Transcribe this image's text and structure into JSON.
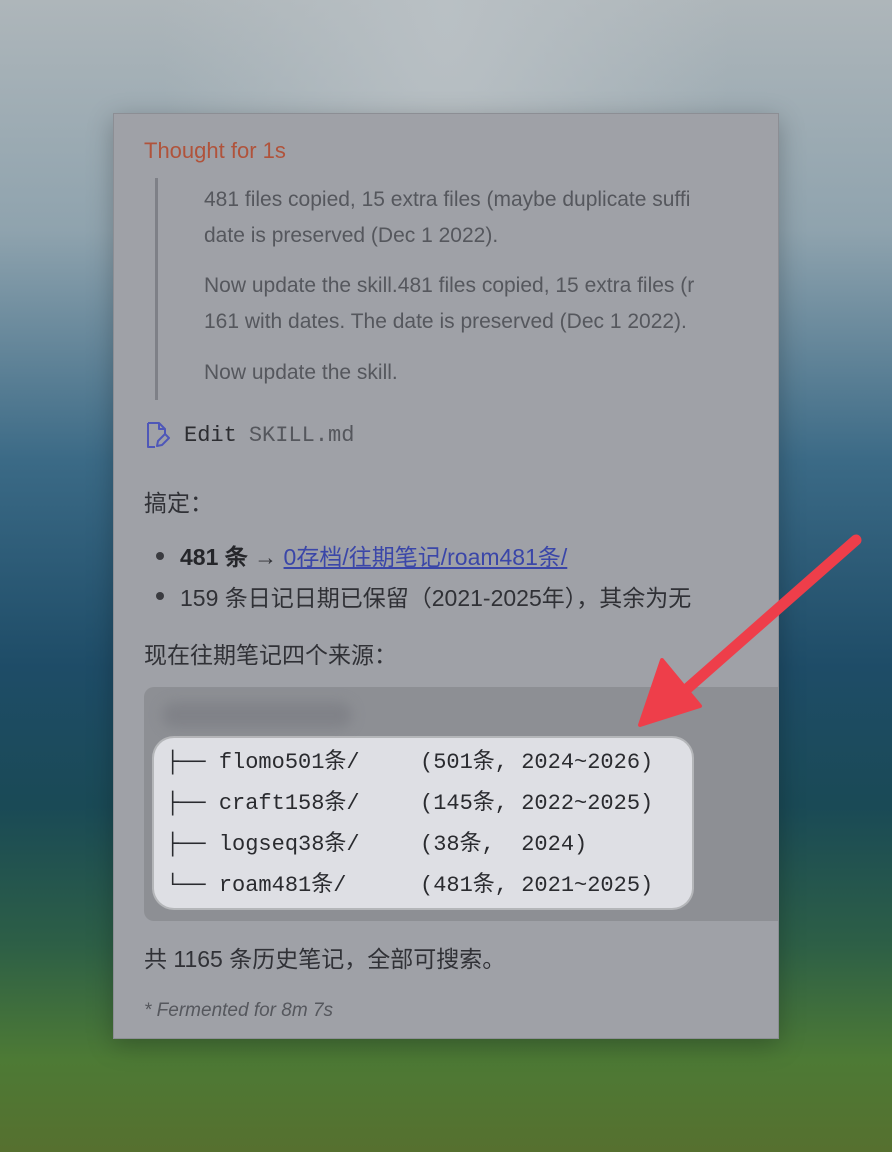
{
  "thought": {
    "title": "Thought for 1s",
    "paragraphs": [
      [
        "481 files copied, 15 extra files (maybe duplicate suffi",
        "date is preserved (Dec 1 2022)."
      ],
      [
        "Now update the skill.481 files copied, 15 extra files (r",
        "161 with dates. The date is preserved (Dec 1 2022)."
      ],
      [
        "Now update the skill."
      ]
    ]
  },
  "edit": {
    "action": "Edit",
    "file": "SKILL.md",
    "icon": "file-edit-icon"
  },
  "message": {
    "done": "搞定：",
    "bullets": [
      {
        "count": "481 条",
        "arrow": "→",
        "link": "0存档/往期笔记/roam481条/"
      },
      {
        "text": "159 条日记日期已保留（2021-2025年），其余为无"
      }
    ],
    "sources_intro": "现在往期笔记四个来源：",
    "tree": [
      {
        "prefix": "├── ",
        "name": "flomo501条/",
        "info": "(501条, 2024~2026)"
      },
      {
        "prefix": "├── ",
        "name": "craft158条/",
        "info": "(145条, 2022~2025)"
      },
      {
        "prefix": "├── ",
        "name": "logseq38条/",
        "info": "(38条,  2024)"
      },
      {
        "prefix": "└── ",
        "name": "roam481条/",
        "info": "(481条, 2021~2025)"
      }
    ],
    "summary": "共 1165 条历史笔记，全部可搜索。"
  },
  "footer": "* Fermented for 8m 7s",
  "colors": {
    "thought_title": "#b0533b",
    "link": "#3a46a8",
    "arrow": "#ee3e4a",
    "panel_bg": "#9fa1a7"
  }
}
